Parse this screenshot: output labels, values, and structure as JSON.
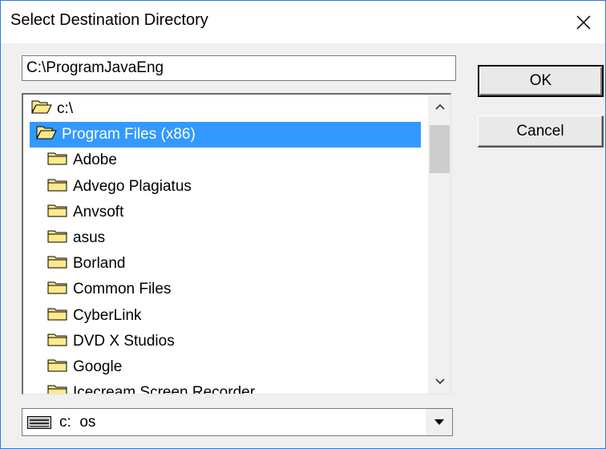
{
  "window": {
    "title": "Select Destination Directory",
    "close_icon": "close-icon"
  },
  "path_input": {
    "value": "C:\\ProgramJavaEng"
  },
  "buttons": {
    "ok_label": "OK",
    "cancel_label": "Cancel"
  },
  "tree": {
    "items": [
      {
        "label": "c:\\",
        "icon": "folder-open-icon",
        "selected": false
      },
      {
        "label": "Program Files (x86)",
        "icon": "folder-open-icon",
        "selected": true
      },
      {
        "label": "Adobe",
        "icon": "folder-icon",
        "selected": false
      },
      {
        "label": "Advego Plagiatus",
        "icon": "folder-icon",
        "selected": false
      },
      {
        "label": "Anvsoft",
        "icon": "folder-icon",
        "selected": false
      },
      {
        "label": "asus",
        "icon": "folder-icon",
        "selected": false
      },
      {
        "label": "Borland",
        "icon": "folder-icon",
        "selected": false
      },
      {
        "label": "Common Files",
        "icon": "folder-icon",
        "selected": false
      },
      {
        "label": "CyberLink",
        "icon": "folder-icon",
        "selected": false
      },
      {
        "label": "DVD X Studios",
        "icon": "folder-icon",
        "selected": false
      },
      {
        "label": "Google",
        "icon": "folder-icon",
        "selected": false
      },
      {
        "label": "Icecream Screen Recorder",
        "icon": "folder-icon",
        "selected": false
      }
    ]
  },
  "drive": {
    "label": "c:  os",
    "icon": "drive-icon"
  },
  "colors": {
    "selection": "#3399ff",
    "window_border": "#2b7bd6",
    "folder_fill": "#ffe98a"
  }
}
